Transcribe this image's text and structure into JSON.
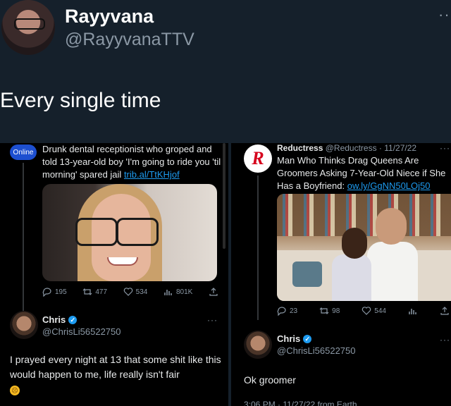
{
  "header": {
    "name": "Rayyvana",
    "handle": "@RayyvanaTTV",
    "more": "··",
    "tweet_text": "Every single time"
  },
  "left": {
    "badge": "Online",
    "text": "Drunk dental receptionist who groped and told 13-year-old boy 'I'm going to ride you 'til morning' spared jail ",
    "link": "trib.al/TtKHjof",
    "stats": {
      "replies": "195",
      "retweets": "477",
      "likes": "534",
      "views": "801K"
    },
    "reply": {
      "name": "Chris",
      "handle": "@ChrisLi56522750",
      "more": "···",
      "text": "I prayed every night at 13 that some shit like this would happen to me, life really isn't fair"
    }
  },
  "right": {
    "logo_letter": "R",
    "name": "Reductress",
    "handle_time": "@Reductress · 11/27/22",
    "more": "···",
    "text": "Man Who Thinks Drag Queens Are Groomers Asking 7-Year-Old Niece if She Has a Boyfriend: ",
    "link": "ow.ly/GgNN50LOj50",
    "stats": {
      "replies": "23",
      "retweets": "98",
      "likes": "544"
    },
    "reply": {
      "name": "Chris",
      "handle": "@ChrisLi56522750",
      "more": "···",
      "text": "Ok groomer",
      "footer": "3:06 PM · 11/27/22 from Earth"
    }
  },
  "colors": {
    "accent": "#1d9bf0",
    "background": "#15202b",
    "panel": "#000000",
    "muted": "#8b98a5"
  },
  "icons": [
    "reply-icon",
    "retweet-icon",
    "like-icon",
    "views-icon",
    "share-icon",
    "verified-icon"
  ]
}
